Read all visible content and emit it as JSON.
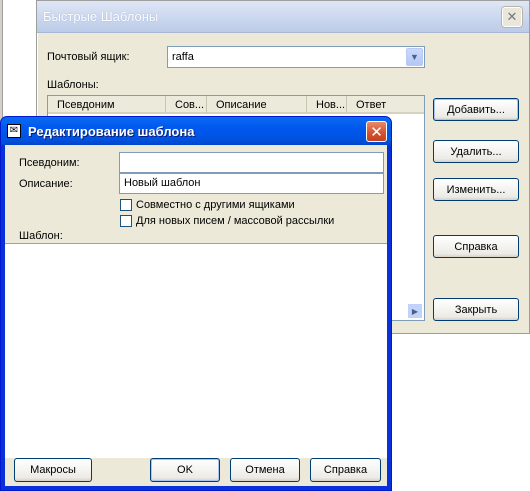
{
  "back_window": {
    "title": "Быстрые Шаблоны",
    "mailbox_label": "Почтовый ящик:",
    "mailbox_value": "raffa",
    "templates_label": "Шаблоны:",
    "columns": [
      "Псевдоним",
      "Сов...",
      "Описание",
      "Нов...",
      "Ответ"
    ],
    "buttons": {
      "add": "Добавить...",
      "delete": "Удалить...",
      "edit": "Изменить...",
      "help": "Справка",
      "close": "Закрыть"
    }
  },
  "dialog": {
    "title": "Редактирование шаблона",
    "alias_label": "Псевдоним:",
    "alias_value": "",
    "description_label": "Описание:",
    "description_value": "Новый шаблон",
    "shared_checkbox": "Совместно с другими ящиками",
    "new_mail_checkbox": "Для новых писем / массовой рассылки",
    "template_label": "Шаблон:",
    "buttons": {
      "macros": "Макросы",
      "ok": "OK",
      "cancel": "Отмена",
      "help": "Справка"
    }
  },
  "icons": {
    "app": "app-icon",
    "close": "close-icon",
    "dropdown": "chevron-down-icon",
    "scroll": "scroll-right-icon"
  }
}
